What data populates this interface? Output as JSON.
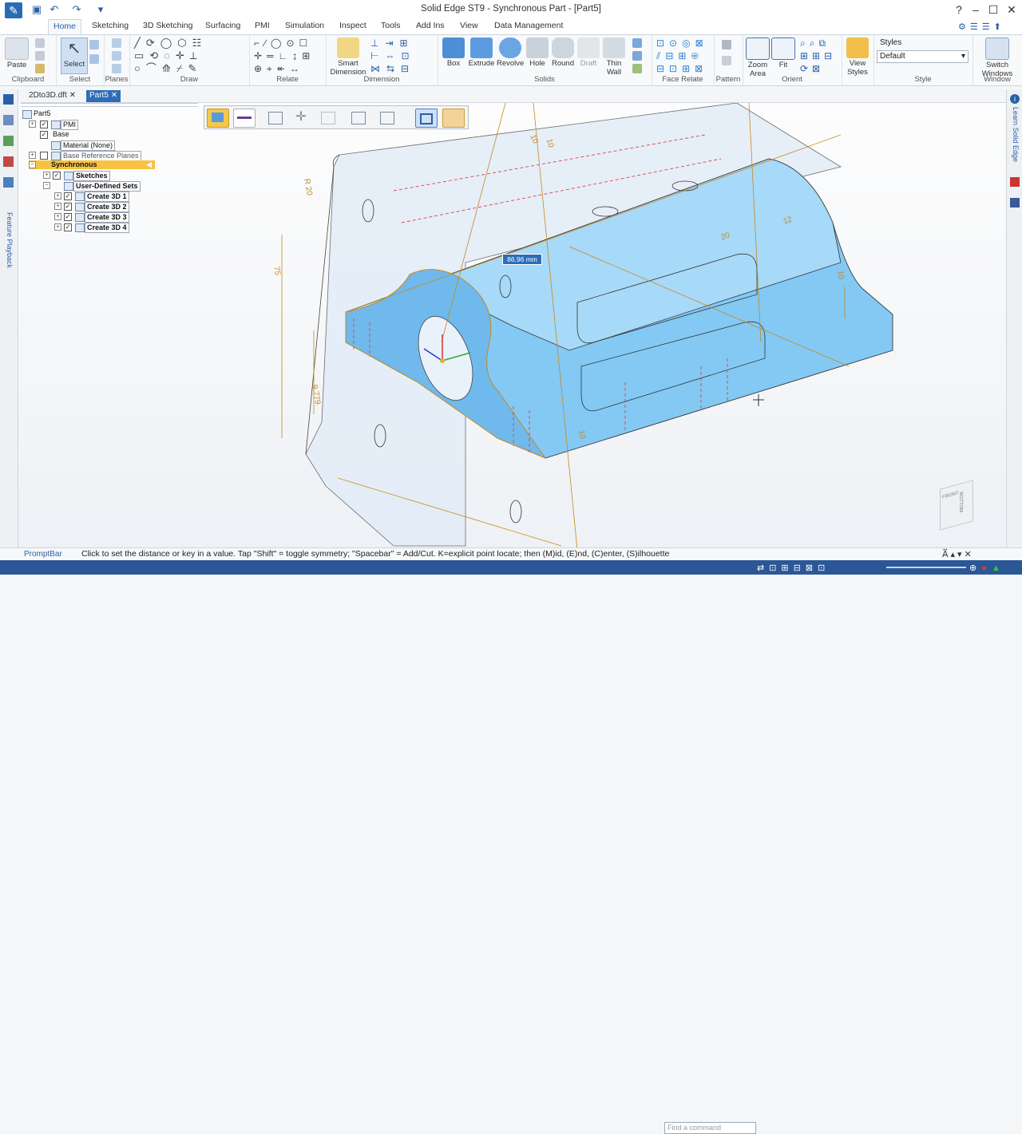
{
  "window": {
    "title": "Solid Edge ST9 - Synchronous Part - [Part5]"
  },
  "ribbon_tabs": [
    "Home",
    "Sketching",
    "3D Sketching",
    "Surfacing",
    "PMI",
    "Simulation",
    "Inspect",
    "Tools",
    "Add Ins",
    "View",
    "Data Management"
  ],
  "ribbon": {
    "clipboard": {
      "label": "Clipboard",
      "paste": "Paste"
    },
    "select": {
      "label": "Select",
      "select": "Select"
    },
    "planes": {
      "label": "Planes"
    },
    "draw": {
      "label": "Draw"
    },
    "relate": {
      "label": "Relate"
    },
    "dimension": {
      "label": "Dimension",
      "smart1": "Smart",
      "smart2": "Dimension"
    },
    "solids": {
      "label": "Solids",
      "box": "Box",
      "extrude": "Extrude",
      "revolve": "Revolve",
      "hole": "Hole",
      "round": "Round",
      "draft": "Draft",
      "thin1": "Thin",
      "thin2": "Wall"
    },
    "face_relate": {
      "label": "Face Relate"
    },
    "pattern": {
      "label": "Pattern"
    },
    "orient": {
      "label": "Orient",
      "zoom1": "Zoom",
      "zoom2": "Area",
      "fit": "Fit"
    },
    "view_styles": {
      "v1": "View",
      "v2": "Styles"
    },
    "style": {
      "label": "Style",
      "styles": "Styles",
      "default": "Default"
    },
    "window": {
      "label": "Window",
      "s1": "Switch",
      "s2": "Windows"
    }
  },
  "doc_tabs": [
    "2Dto3D.dft",
    "Part5"
  ],
  "pathfinder": {
    "root": "Part5",
    "pmi": "PMI",
    "base": "Base",
    "material": "Material (None)",
    "base_planes": "Base Reference Planes",
    "synchronous": "Synchronous",
    "sketches": "Sketches",
    "user_sets": "User-Defined Sets",
    "features": [
      "Create 3D 1",
      "Create 3D 2",
      "Create 3D 3",
      "Create 3D 4"
    ]
  },
  "side_labels": {
    "feature_playback": "Feature Playback",
    "learn": "Learn Solid Edge"
  },
  "viewport": {
    "dynamic_value": "86.96 mm",
    "dims": [
      "10",
      "R 20",
      "75",
      "9.779",
      "10",
      "20",
      "12",
      "10",
      "10"
    ],
    "view_cube": [
      "FRONT",
      "BOTTOM"
    ]
  },
  "prompt": {
    "label": "PromptBar",
    "text": "Click to set the distance or key in a value.  Tap \"Shift\" = toggle symmetry; \"Spacebar\" = Add/Cut.  K=explicit point locate; then (M)id, (E)nd, (C)enter, (S)ilhouette"
  },
  "status": {
    "find_placeholder": "Find a command"
  },
  "colors": {
    "accent": "#2b5797",
    "part_fill": "#7fc7f5",
    "part_stroke": "#3a3a3a",
    "dimension": "#c88a1e"
  }
}
